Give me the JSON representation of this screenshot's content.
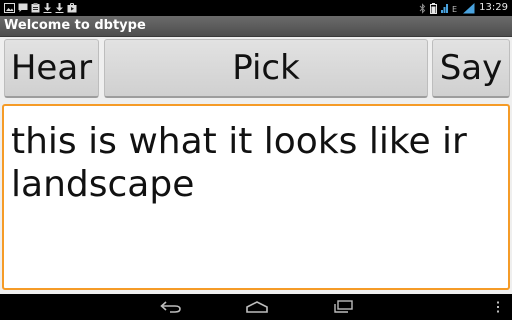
{
  "status_bar": {
    "time": "13:29",
    "left_icons": [
      "image-notification-icon",
      "chat-notification-icon",
      "clipboard-notification-icon",
      "download-icon",
      "download-icon",
      "play-store-icon"
    ],
    "right_icons": [
      "bluetooth-icon",
      "battery-icon",
      "signal-icon",
      "edge-network-icon",
      "signal-bars-icon"
    ]
  },
  "app": {
    "title": "Welcome to dbtype"
  },
  "buttons": {
    "hear_label": "Hear",
    "pick_label": "Pick",
    "say_label": "Say"
  },
  "text_area": {
    "line1": "this is what it looks like ir",
    "line2": "landscape"
  },
  "nav_bar": {
    "buttons": [
      "back-icon",
      "home-icon",
      "recent-apps-icon",
      "overflow-menu-icon"
    ]
  },
  "colors": {
    "focus_border": "#f59b27",
    "status_bar_bg": "#000000",
    "title_bar_bg": "#5a5a5a"
  }
}
